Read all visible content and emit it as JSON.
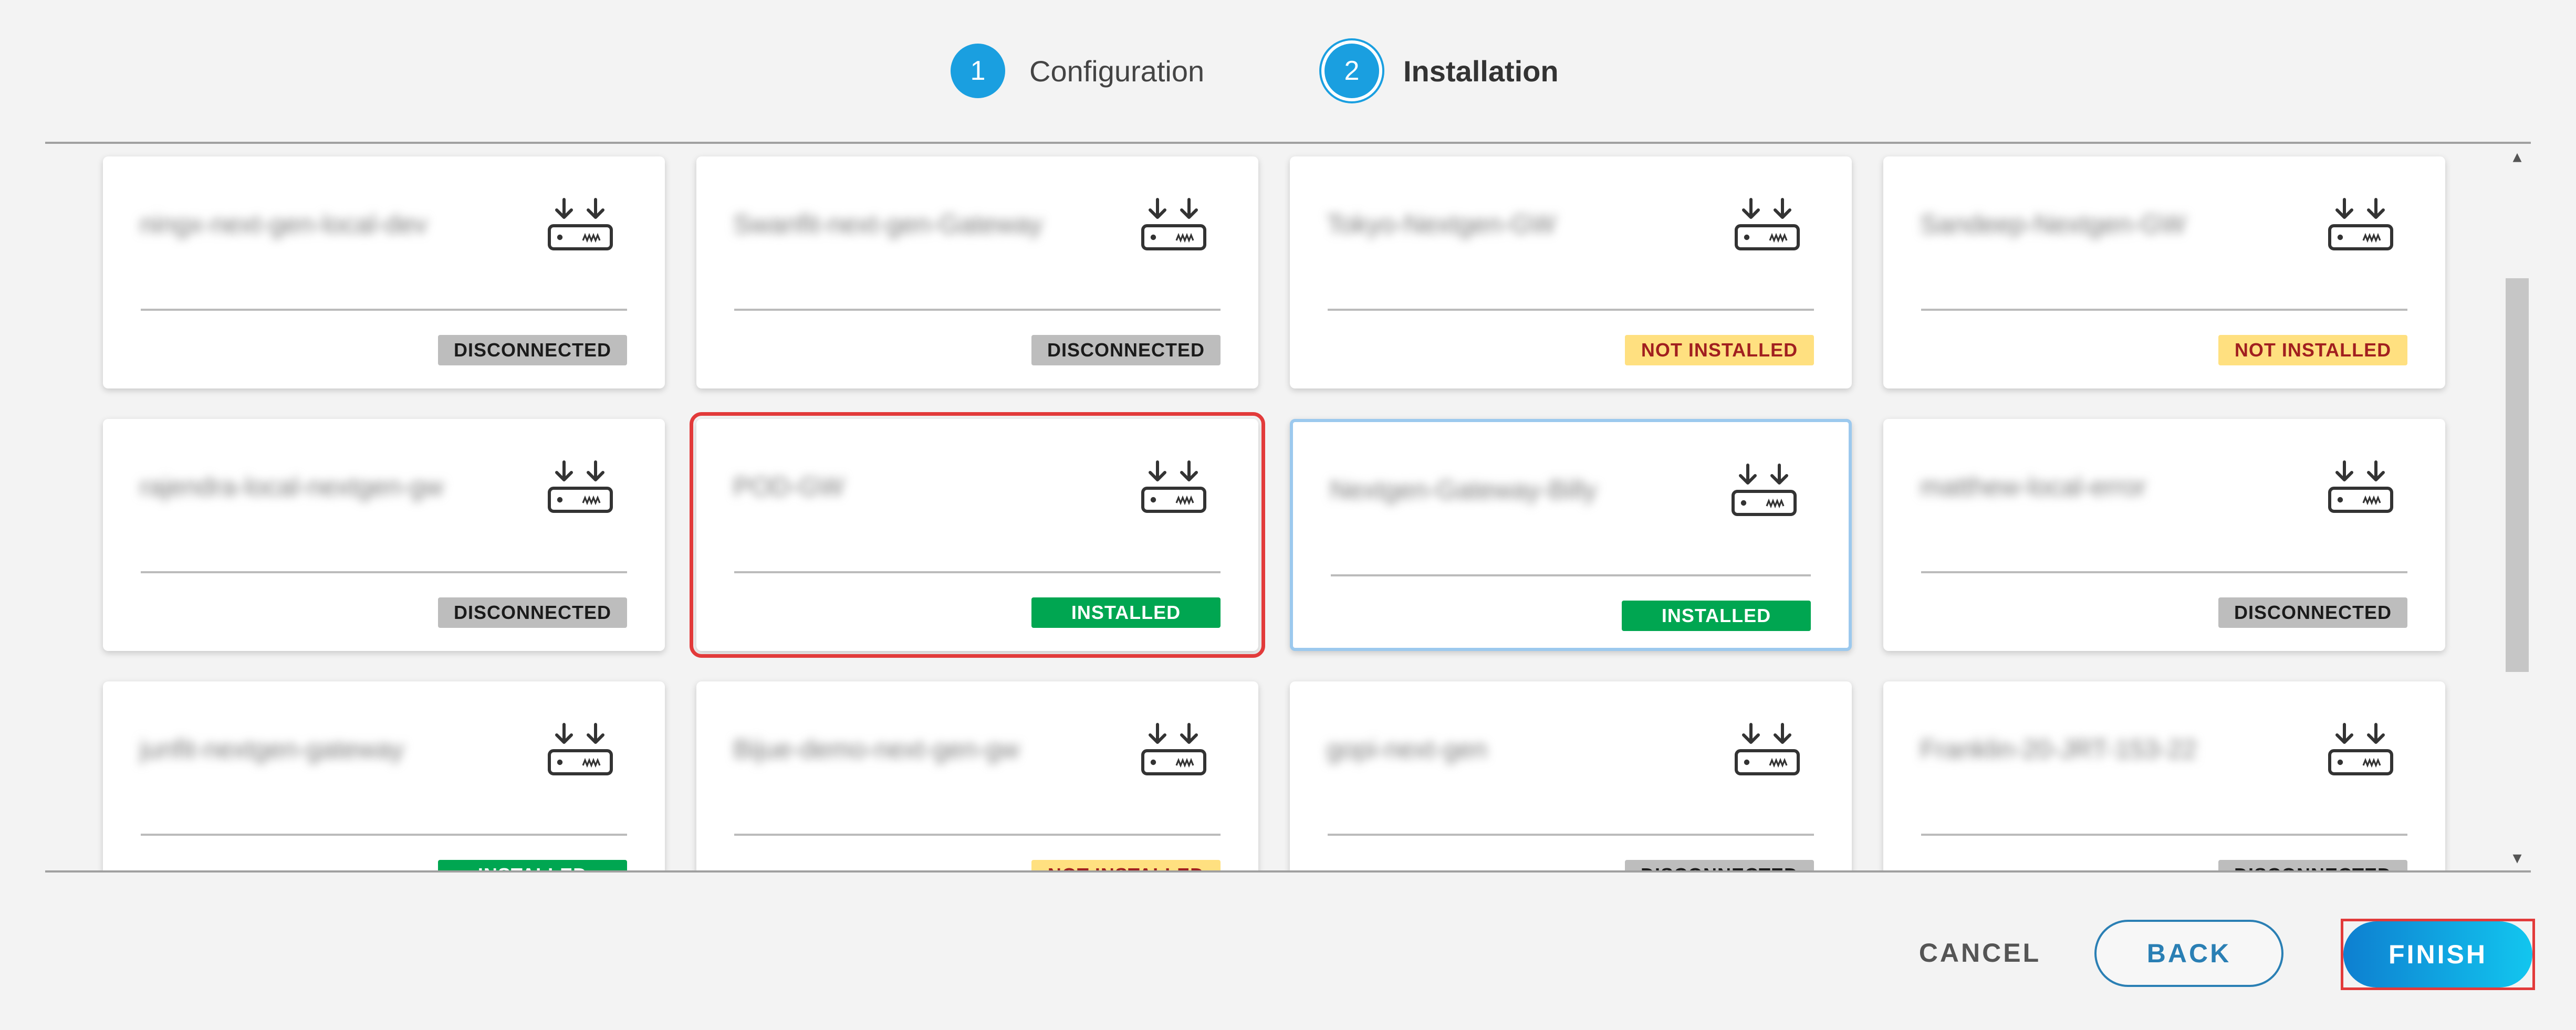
{
  "stepper": {
    "steps": [
      {
        "number": "1",
        "label": "Configuration"
      },
      {
        "number": "2",
        "label": "Installation"
      }
    ]
  },
  "devices": [
    {
      "name": "ningx-next-gen-local-dev",
      "status": "DISCONNECTED"
    },
    {
      "name": "Swanfit-next-gen-Gateway",
      "status": "DISCONNECTED"
    },
    {
      "name": "Tokyo-Nextgen-GW",
      "status": "NOT INSTALLED"
    },
    {
      "name": "Sandeep-Nextgen-GW",
      "status": "NOT INSTALLED"
    },
    {
      "name": "rajendra-local-nextgen-gw",
      "status": "DISCONNECTED"
    },
    {
      "name": "POD-GW",
      "status": "INSTALLED"
    },
    {
      "name": "Nextgen-Gateway-Billy",
      "status": "INSTALLED"
    },
    {
      "name": "matthew-local-error",
      "status": "DISCONNECTED"
    },
    {
      "name": "junfit-nextgen-gateway",
      "status": "INSTALLED"
    },
    {
      "name": "Bijue-demo-next-gen-gw",
      "status": "NOT INSTALLED"
    },
    {
      "name": "gopi-next-gen",
      "status": "DISCONNECTED"
    },
    {
      "name": "Franklin-20-JRT-153-22",
      "status": "DISCONNECTED"
    }
  ],
  "footer": {
    "cancel_label": "CANCEL",
    "back_label": "BACK",
    "finish_label": "FINISH"
  },
  "colors": {
    "accent": "#1a9fe0",
    "installed": "#00a651",
    "not_installed_bg": "#ffe080",
    "not_installed_text": "#a11f1f",
    "disconnected": "#bdbdbd",
    "highlight": "#e23a3a"
  },
  "icons": {
    "device": "gateway-download-icon",
    "scroll_up": "chevron-up-icon",
    "scroll_down": "chevron-down-icon"
  }
}
